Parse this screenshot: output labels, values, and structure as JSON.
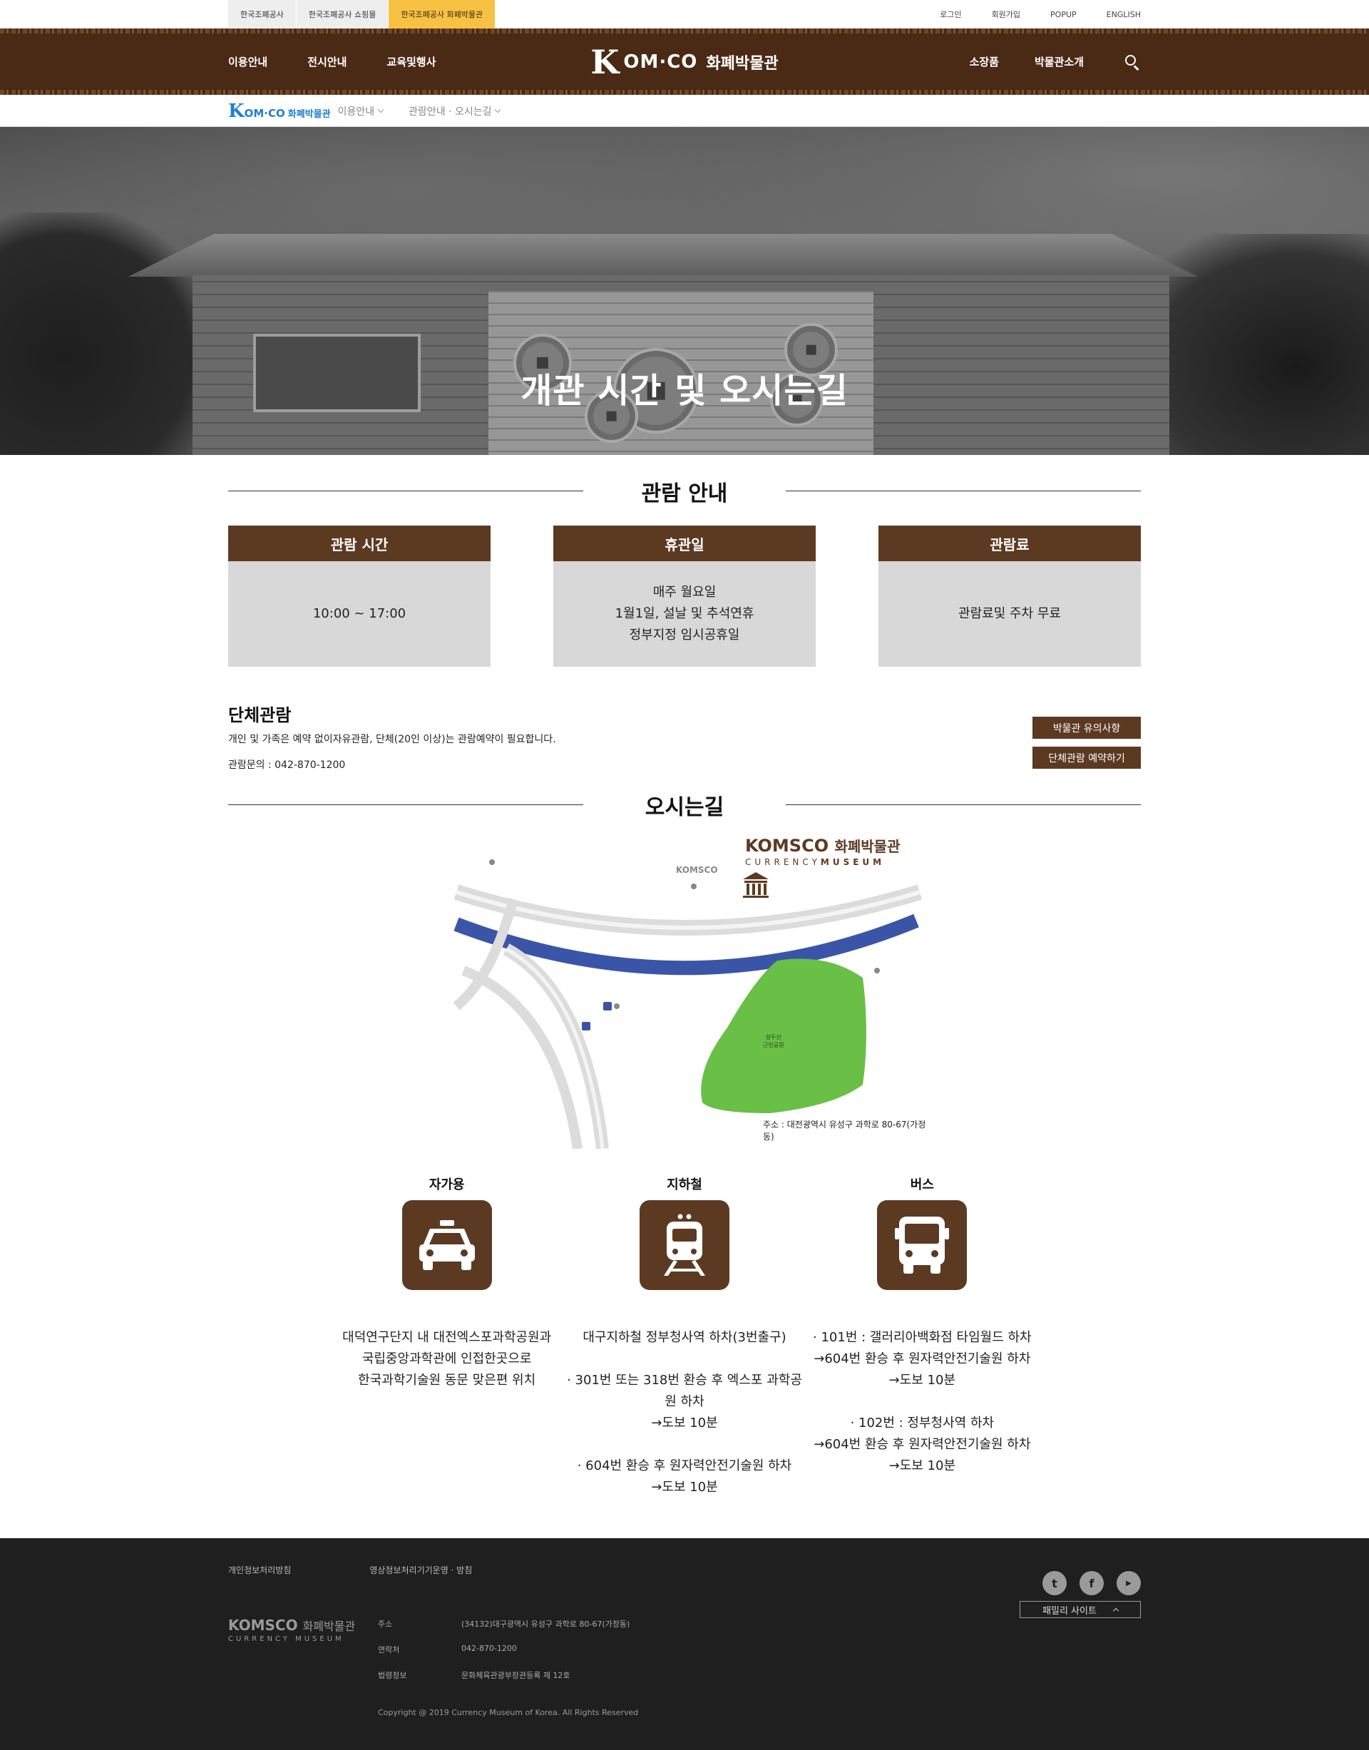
{
  "topbar": {
    "site_tabs": [
      "한국조폐공사",
      "한국조폐공사 쇼핑몰",
      "한국조폐공사 화폐박물관"
    ],
    "util_links": [
      "로그인",
      "회원가입",
      "POPUP",
      "ENGLISH"
    ]
  },
  "nav": {
    "left": [
      "이용안내",
      "전시안내",
      "교육및행사"
    ],
    "right": [
      "소장품",
      "박물관소개"
    ],
    "logo_k": "K",
    "logo_om": "OM·CO",
    "logo_kr": "화폐박물관"
  },
  "breadcrumb": {
    "logo_k": "K",
    "logo_om": "OM·CO",
    "logo_kr": "화폐박물관",
    "items": [
      "이용안내",
      "관람안내 · 오시는길"
    ]
  },
  "hero": {
    "title": "개관 시간 및 오시는길"
  },
  "viewing": {
    "title": "관람 안내",
    "cards": [
      {
        "head": "관람 시간",
        "lines": [
          "10:00 ~ 17:00"
        ]
      },
      {
        "head": "휴관일",
        "lines": [
          "매주 월요일",
          "1월1일, 설날 및 추석연휴",
          "정부지정 임시공휴일"
        ]
      },
      {
        "head": "관람료",
        "lines": [
          "관람료및 주차 무료"
        ]
      }
    ]
  },
  "group": {
    "title": "단체관람",
    "desc": "개인 및 가족은 예약 없이자유관람, 단체(20인 이상)는 관람예약이 필요합니다.",
    "phone": "관람문의 : 042-870-1200",
    "btn_notice": "박물관 유의사항",
    "btn_reserve": "단체관람 예약하기"
  },
  "directions": {
    "title": "오시는길",
    "brand_main": "KOMSCO",
    "brand_kr": "화폐박물관",
    "brand_sub_1": "CURRENCY",
    "brand_sub_2": "MUSEUM",
    "mini_komsco": "KOMSCO",
    "park_label_1": "성두산",
    "park_label_2": "근린공원",
    "address": "주소 : 대전광역시 유성구 과학로 80-67(가정동)"
  },
  "transport": [
    {
      "title": "자가용",
      "icon": "car-icon",
      "desc": "대덕연구단지 내 대전엑스포과학공원과\n국립중앙과학관에 인접한곳으로\n한국과학기술원 동문 맞은편 위치"
    },
    {
      "title": "지하철",
      "icon": "subway-icon",
      "desc": "대구지하철 정부청사역 하차(3번출구)\n\n· 301번 또는 318번 환승 후 엑스포 과학공원 하차\n→도보 10분\n\n· 604번 환승 후 원자력안전기술원 하차\n→도보 10분"
    },
    {
      "title": "버스",
      "icon": "bus-icon",
      "desc": "· 101번 : 갤러리아백화점 타임월드 하차\n→604번 환승 후 원자력안전기술원 하차\n→도보 10분\n\n· 102번 : 정부청사역  하차\n→604번 환승 후 원자력안전기술원 하차\n→도보 10분"
    }
  ],
  "footer": {
    "links": [
      "개인정보처리방침",
      "영상정보처리기기운영 · 방침"
    ],
    "logo_main": "KOMSCO",
    "logo_kr": "화폐박물관",
    "logo_sub": "CURRENCY MUSEUM",
    "info": [
      {
        "k": "주소",
        "v": "(34132)대구광역시 유성구 과학로 80-67(가정동)"
      },
      {
        "k": "연락처",
        "v": "042-870-1200"
      },
      {
        "k": "법령정보",
        "v": "문화체육관광부장관등록 제 12호"
      }
    ],
    "copyright": "Copyright @ 2019 Currency Museum of Korea. All Rights Reserved",
    "family_site": "패밀리 사이트",
    "social": [
      "twitter-icon",
      "facebook-icon",
      "youtube-icon"
    ]
  }
}
